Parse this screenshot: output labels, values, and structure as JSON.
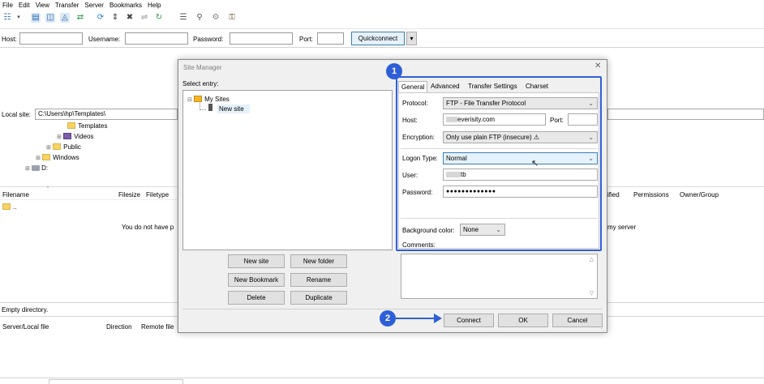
{
  "menu": [
    "File",
    "Edit",
    "View",
    "Transfer",
    "Server",
    "Bookmarks",
    "Help"
  ],
  "quickconnect": {
    "host_label": "Host:",
    "username_label": "Username:",
    "password_label": "Password:",
    "port_label": "Port:",
    "button": "Quickconnect"
  },
  "local": {
    "site_label": "Local site:",
    "path": "C:\\Users\\hp\\Templates\\",
    "tree": [
      "Templates",
      "Videos",
      "Public",
      "Windows",
      "D:"
    ],
    "columns": [
      "Filename",
      "Filesize",
      "Filetype"
    ],
    "parent_dir": "..",
    "status": "Empty directory."
  },
  "remote": {
    "columns": [
      "ified",
      "Permissions",
      "Owner/Group"
    ],
    "message_left": "You do not have p",
    "message_right": "my server"
  },
  "queue": {
    "columns": [
      "Server/Local file",
      "Direction",
      "Remote file"
    ]
  },
  "dialog": {
    "title": "Site Manager",
    "select_entry": "Select entry:",
    "tree_root": "My Sites",
    "tree_site": "New site",
    "buttons_left": [
      "New site",
      "New folder",
      "New Bookmark",
      "Rename",
      "Delete",
      "Duplicate"
    ],
    "tabs": [
      "General",
      "Advanced",
      "Transfer Settings",
      "Charset"
    ],
    "protocol_label": "Protocol:",
    "protocol_value": "FTP - File Transfer Protocol",
    "host_label": "Host:",
    "host_value": "everisity.com",
    "port_label": "Port:",
    "encryption_label": "Encryption:",
    "encryption_value": "Only use plain FTP (insecure) ⚠",
    "logon_label": "Logon Type:",
    "logon_value": "Normal",
    "user_label": "User:",
    "user_value": "tb",
    "password_label": "Password:",
    "password_value": "●●●●●●●●●●●●●",
    "bgcolor_label": "Background color:",
    "bgcolor_value": "None",
    "comments_label": "Comments:",
    "connect": "Connect",
    "ok": "OK",
    "cancel": "Cancel"
  },
  "annotations": {
    "badge1": "1",
    "badge2": "2",
    "accent_color": "#2f5fd8"
  }
}
